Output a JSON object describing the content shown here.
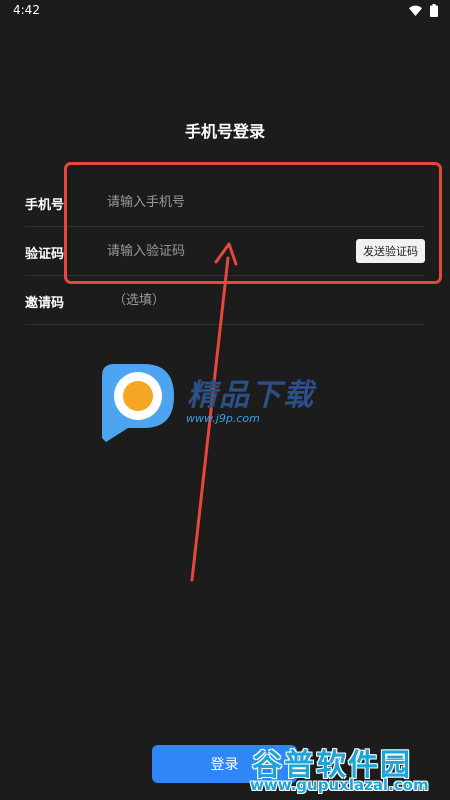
{
  "status_bar": {
    "time": "4:42",
    "icons": [
      "wifi-icon",
      "battery-icon"
    ]
  },
  "page": {
    "title": "手机号登录"
  },
  "form": {
    "phone": {
      "label": "手机号",
      "placeholder": "请输入手机号",
      "value": ""
    },
    "code": {
      "label": "验证码",
      "placeholder": "请输入验证码",
      "value": "",
      "send_button": "发送验证码"
    },
    "invite": {
      "label": "邀请码",
      "placeholder": "（选填）",
      "value": ""
    }
  },
  "login_button": "登录",
  "logo_watermark": {
    "text": "精品下载",
    "url": "www.j9p.com"
  },
  "site_watermark": {
    "text": "谷普软件园",
    "url": "www.gupuxlazal.com"
  },
  "colors": {
    "background": "#1c1c1c",
    "highlight": "#e8473b",
    "primary": "#2f86f6"
  }
}
